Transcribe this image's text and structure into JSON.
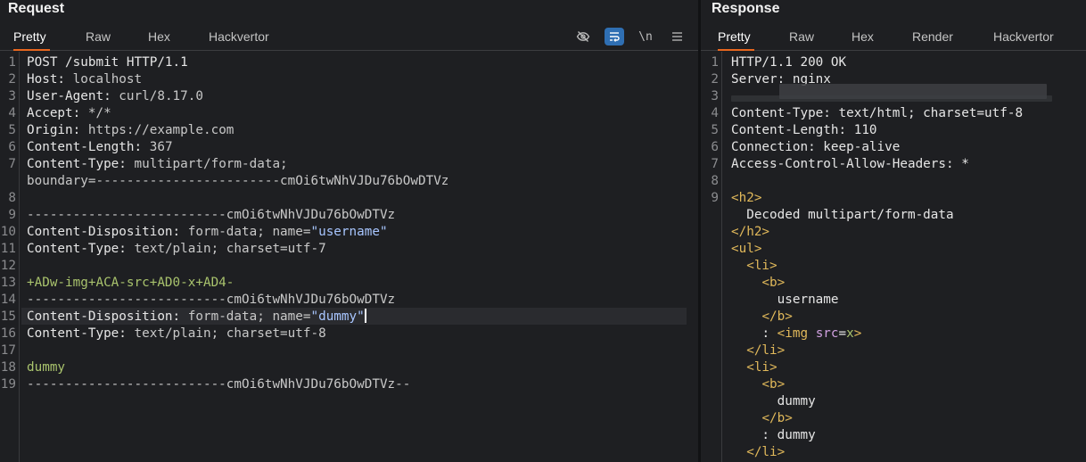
{
  "request": {
    "title": "Request",
    "tabs": [
      "Pretty",
      "Raw",
      "Hex",
      "Hackvertor"
    ],
    "active_tab": "Pretty",
    "toolbar": {
      "hide_icon": "eye-off-icon",
      "wrap_icon": "wrap-icon",
      "newline_label": "\\n",
      "menu_icon": "menu-icon"
    },
    "lines": [
      {
        "n": "1",
        "key": "POST /submit HTTP/1.1",
        "rest": ""
      },
      {
        "n": "2",
        "key": "Host:",
        "rest": " localhost"
      },
      {
        "n": "3",
        "key": "User-Agent:",
        "rest": " curl/8.17.0"
      },
      {
        "n": "4",
        "key": "Accept:",
        "rest": " */*"
      },
      {
        "n": "5",
        "key": "Origin:",
        "rest": " https://example.com"
      },
      {
        "n": "6",
        "key": "Content-Length:",
        "rest": " 367"
      },
      {
        "n": "7",
        "key": "Content-Type:",
        "rest": " multipart/form-data;"
      },
      {
        "n": "",
        "key": "",
        "rest": "boundary=------------------------cmOi6twNhVJDu76bOwDTVz"
      },
      {
        "n": "8",
        "key": "",
        "rest": ""
      },
      {
        "n": "9",
        "key": "",
        "rest": "--------------------------cmOi6twNhVJDu76bOwDTVz"
      },
      {
        "n": "10",
        "key": "Content-Disposition:",
        "rest": " form-data; name=",
        "str": "\"username\""
      },
      {
        "n": "11",
        "key": "Content-Type:",
        "rest": " text/plain; charset=utf-7"
      },
      {
        "n": "12",
        "key": "",
        "rest": ""
      },
      {
        "n": "13",
        "key": "",
        "rest": "",
        "green": "+ADw-img+ACA-src+AD0-x+AD4-"
      },
      {
        "n": "14",
        "key": "",
        "rest": "--------------------------cmOi6twNhVJDu76bOwDTVz"
      },
      {
        "n": "15",
        "key": "Content-Disposition:",
        "rest": " form-data; name=",
        "str": "\"dummy\""
      },
      {
        "n": "16",
        "key": "Content-Type:",
        "rest": " text/plain; charset=utf-8"
      },
      {
        "n": "17",
        "key": "",
        "rest": ""
      },
      {
        "n": "18",
        "key": "",
        "rest": "",
        "green": "dummy"
      },
      {
        "n": "19",
        "key": "",
        "rest": "--------------------------cmOi6twNhVJDu76bOwDTVz--"
      }
    ]
  },
  "response": {
    "title": "Response",
    "tabs": [
      "Pretty",
      "Raw",
      "Hex",
      "Render",
      "Hackvertor"
    ],
    "active_tab": "Pretty",
    "lines": [
      {
        "n": "1",
        "text": "HTTP/1.1 200 OK"
      },
      {
        "n": "2",
        "text": "Server: nginx"
      },
      {
        "n": "3",
        "text": ""
      },
      {
        "n": "4",
        "text": "Content-Type: text/html; charset=utf-8"
      },
      {
        "n": "5",
        "text": "Content-Length: 110"
      },
      {
        "n": "6",
        "text": "Connection: keep-alive"
      },
      {
        "n": "7",
        "text": "Access-Control-Allow-Headers: *"
      },
      {
        "n": "8",
        "text": ""
      },
      {
        "n": "9",
        "tag": "<h2>"
      },
      {
        "n": "",
        "text": "  Decoded multipart/form-data"
      },
      {
        "n": "",
        "tag": "</h2>"
      },
      {
        "n": "",
        "tag": "<ul>"
      },
      {
        "n": "",
        "indent": "  ",
        "tag": "<li>"
      },
      {
        "n": "",
        "indent": "    ",
        "tag": "<b>"
      },
      {
        "n": "",
        "text": "      username"
      },
      {
        "n": "",
        "indent": "    ",
        "tag": "</b>"
      },
      {
        "n": "",
        "indent": "    ",
        "text": ": ",
        "tag": "<img",
        "attr": " src",
        "eq": "=",
        "val": "x",
        "tag2": ">"
      },
      {
        "n": "",
        "indent": "  ",
        "tag": "</li>"
      },
      {
        "n": "",
        "indent": "  ",
        "tag": "<li>"
      },
      {
        "n": "",
        "indent": "    ",
        "tag": "<b>"
      },
      {
        "n": "",
        "text": "      dummy"
      },
      {
        "n": "",
        "indent": "    ",
        "tag": "</b>"
      },
      {
        "n": "",
        "text": "    : dummy"
      },
      {
        "n": "",
        "indent": "  ",
        "tag": "</li>"
      }
    ]
  },
  "colors": {
    "accent": "#e8671f",
    "wrap_button": "#2f6fb3",
    "background": "#1e1f22"
  }
}
